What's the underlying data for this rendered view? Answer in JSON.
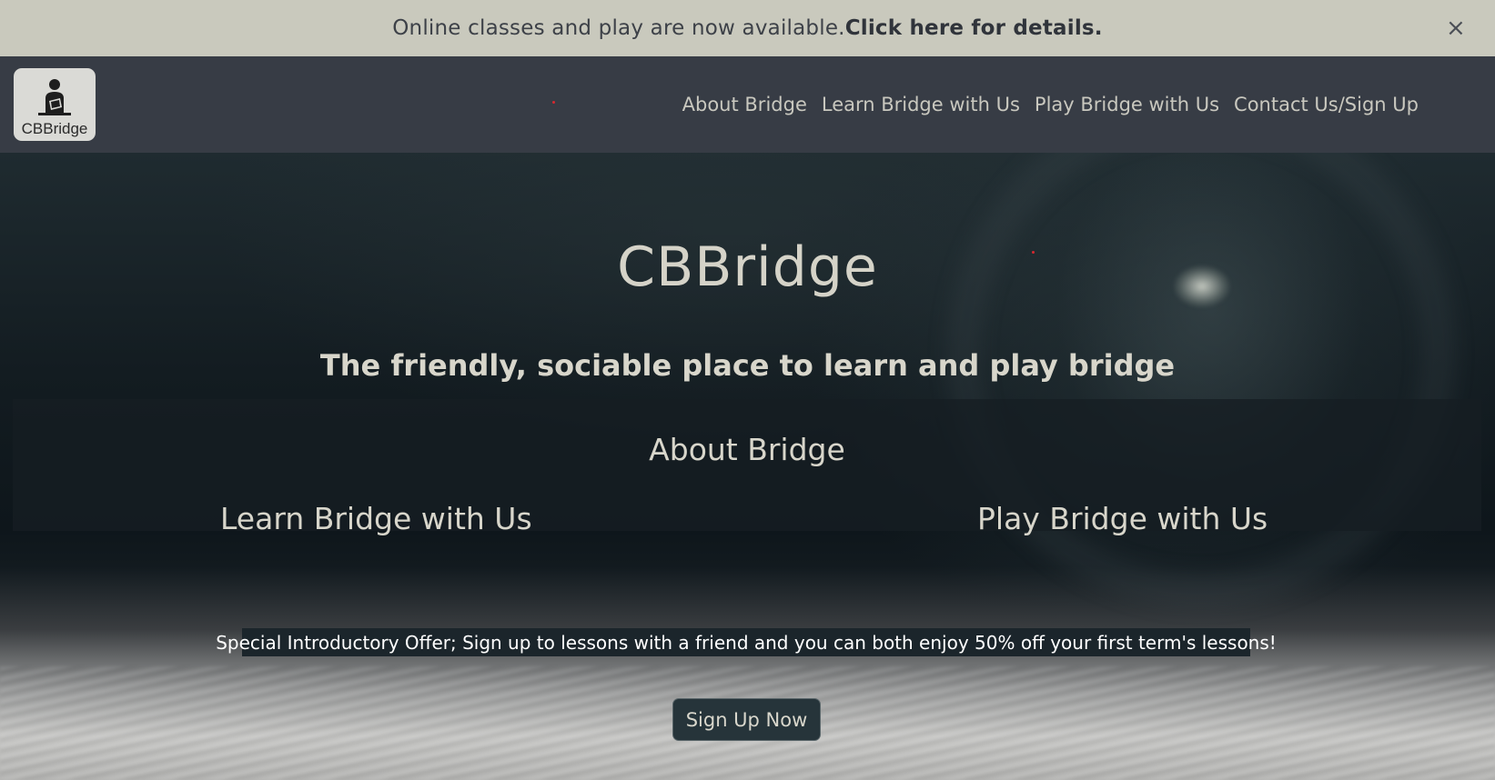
{
  "announcement": {
    "text": "Online classes and play are now available.",
    "link": "Click here for details.",
    "close_icon": "×"
  },
  "header": {
    "logo_text": "CBBridge",
    "logo_icon": "person-reading-icon",
    "nav": [
      {
        "label": "About Bridge"
      },
      {
        "label": "Learn Bridge with Us"
      },
      {
        "label": "Play Bridge with Us"
      },
      {
        "label": "Contact Us/Sign Up"
      }
    ]
  },
  "hero": {
    "title": "CBBridge",
    "subtitle": "The friendly, sociable place to learn and play bridge",
    "panel": {
      "about": "About Bridge",
      "learn": "Learn Bridge with Us",
      "play": "Play Bridge with Us"
    },
    "offer": "Special Introductory Offer; Sign up to lessons with a friend and you can both enjoy 50% off your first term's lessons!",
    "cta": "Sign Up Now"
  },
  "colors": {
    "announcement_bg": "#c9c9bd",
    "header_bg": "#373c45",
    "nav_text": "#c9c8bf",
    "accent_dot": "#d7282f"
  }
}
